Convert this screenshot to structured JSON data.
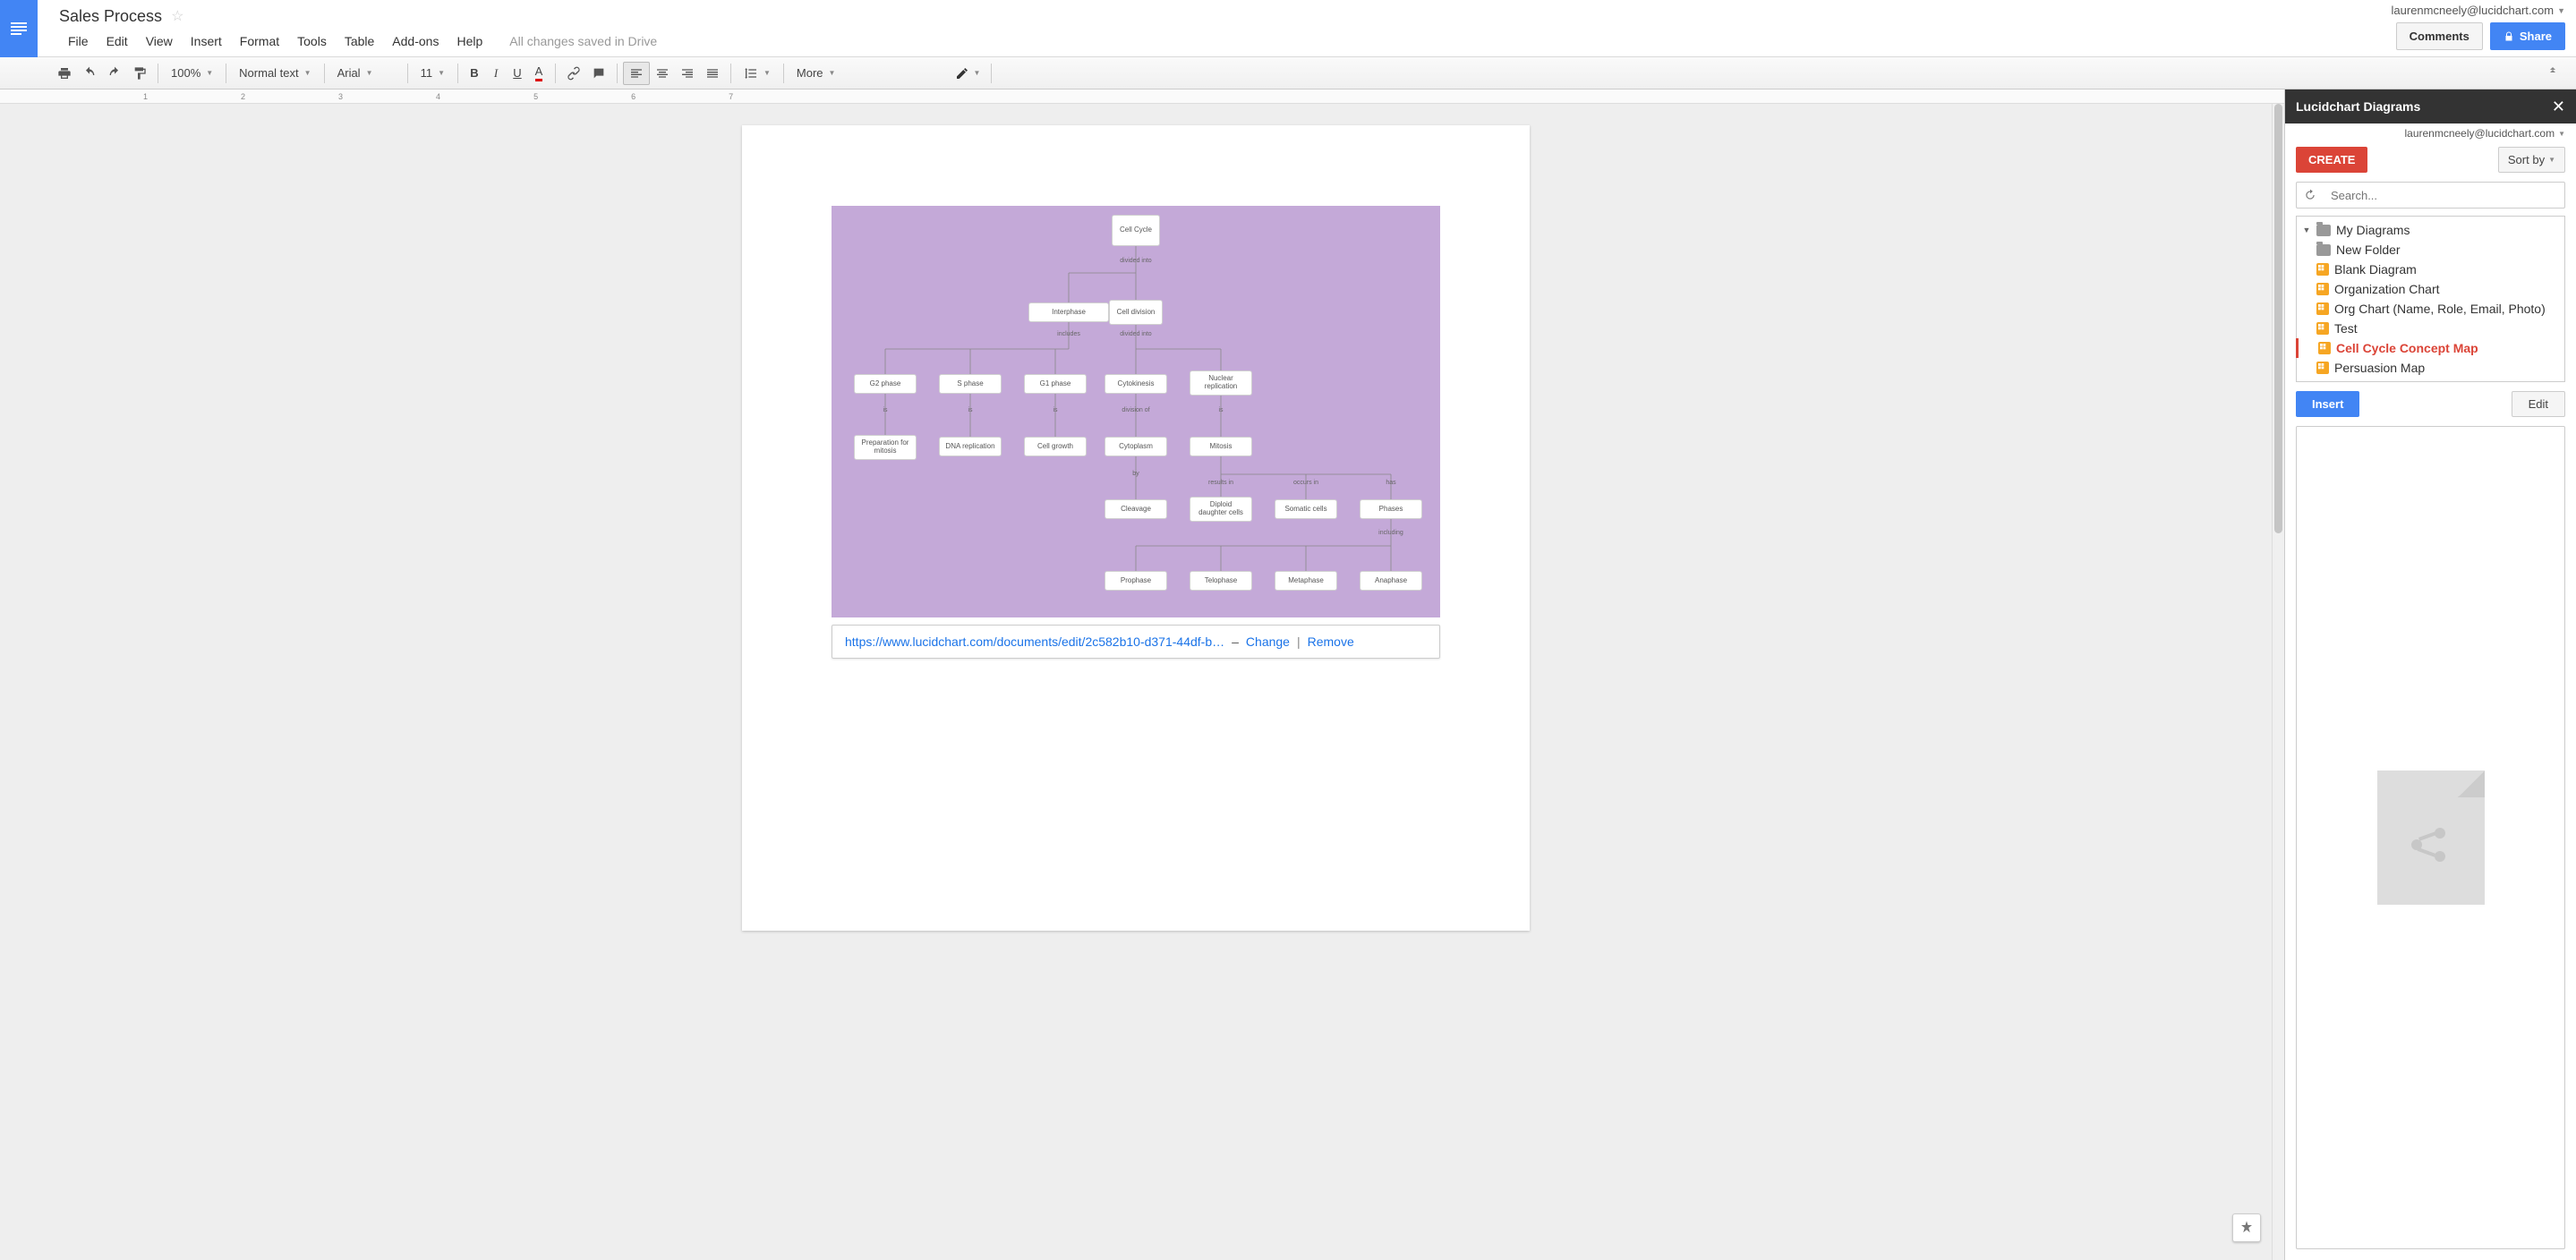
{
  "header": {
    "doc_title": "Sales Process",
    "user_email": "laurenmcneely@lucidchart.com",
    "comments_label": "Comments",
    "share_label": "Share",
    "save_status": "All changes saved in Drive"
  },
  "menu": {
    "file": "File",
    "edit": "Edit",
    "view": "View",
    "insert": "Insert",
    "format": "Format",
    "tools": "Tools",
    "table": "Table",
    "addons": "Add-ons",
    "help": "Help"
  },
  "toolbar": {
    "zoom": "100%",
    "style": "Normal text",
    "font": "Arial",
    "size": "11",
    "more": "More"
  },
  "ruler": [
    "1",
    "2",
    "3",
    "4",
    "5",
    "6",
    "7"
  ],
  "diagram": {
    "boxes": {
      "cell_cycle": "Cell\nCycle",
      "interphase": "Interphase",
      "cell_division": "Cell\ndivision",
      "g2": "G2 phase",
      "s": "S phase",
      "g1": "G1 phase",
      "cytokinesis": "Cytokinesis",
      "nuclear": "Nuclear\nreplication",
      "prep": "Preparation\nfor mitosis",
      "dna": "DNA replication",
      "growth": "Cell growth",
      "cytoplasm": "Cytoplasm",
      "mitosis": "Mitosis",
      "cleavage": "Cleavage",
      "diploid": "Diploid\ndaughter cells",
      "somatic": "Somatic cells",
      "phases": "Phases",
      "prophase": "Prophase",
      "telophase": "Telophase",
      "metaphase": "Metaphase",
      "anaphase": "Anaphase"
    },
    "labels": {
      "divided1": "divided into",
      "includes": "includes",
      "divided2": "divided into",
      "is1": "is",
      "is2": "is",
      "is3": "is",
      "division_of": "division of",
      "is4": "is",
      "by": "by",
      "results": "results in",
      "occurs": "occurs in",
      "has": "has",
      "including": "including"
    }
  },
  "linkbar": {
    "url": "https://www.lucidchart.com/documents/edit/2c582b10-d371-44df-b…",
    "dash": "–",
    "change": "Change",
    "pipe": "|",
    "remove": "Remove"
  },
  "sidebar": {
    "title": "Lucidchart Diagrams",
    "user_email": "laurenmcneely@lucidchart.com",
    "create": "CREATE",
    "sort": "Sort by",
    "search_placeholder": "Search...",
    "tree": {
      "root": "My Diagrams",
      "folder": "New Folder",
      "items": [
        "Blank Diagram",
        "Organization Chart",
        "Org Chart (Name, Role, Email, Photo)",
        "Test",
        "Cell Cycle Concept Map",
        "Persuasion Map"
      ]
    },
    "insert": "Insert",
    "edit": "Edit"
  }
}
